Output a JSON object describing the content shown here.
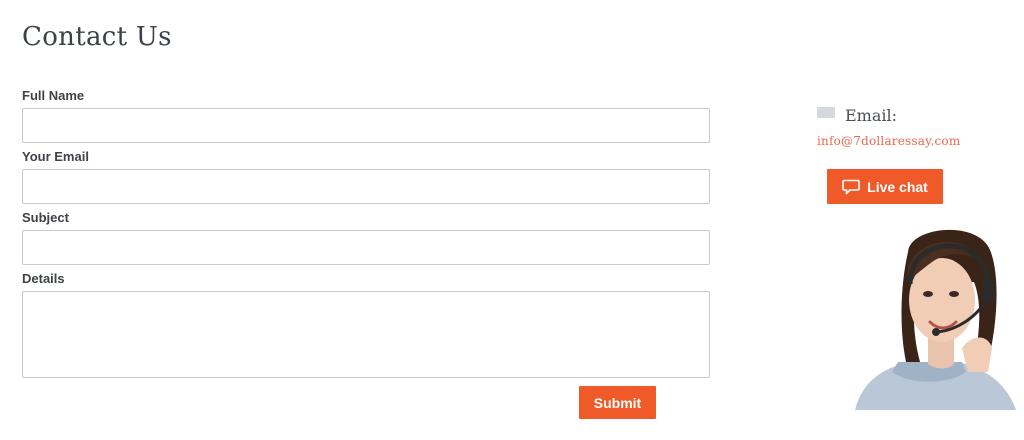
{
  "page": {
    "title": "Contact Us"
  },
  "form": {
    "fields": [
      {
        "label": "Full Name",
        "value": ""
      },
      {
        "label": "Your Email",
        "value": ""
      },
      {
        "label": "Subject",
        "value": ""
      },
      {
        "label": "Details",
        "value": ""
      }
    ],
    "submit_label": "Submit"
  },
  "contact": {
    "email_heading": "Email:",
    "email_address": "info@7dollaressay.com",
    "icon": "envelope-icon",
    "live_chat_label": "Live chat",
    "live_chat_icon": "chat-bubble-icon"
  },
  "colors": {
    "accent": "#f05a28",
    "link": "#e9674a",
    "text": "#3a3f44",
    "border": "#c9c9c9"
  }
}
